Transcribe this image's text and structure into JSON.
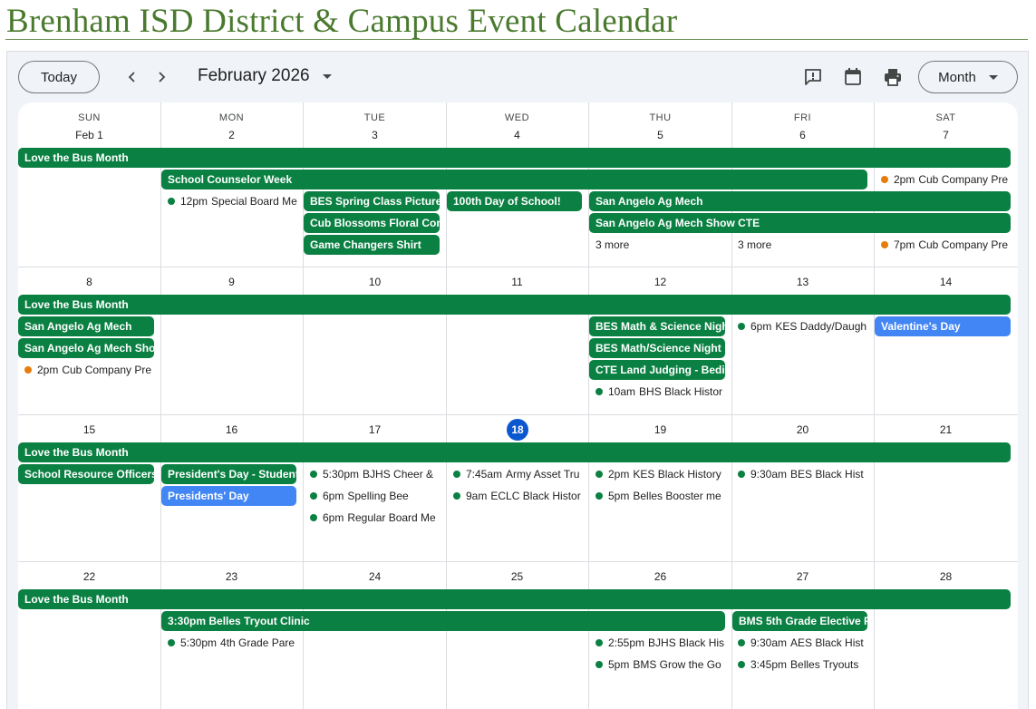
{
  "page_title": "Brenham ISD District & Campus Event Calendar",
  "toolbar": {
    "today_label": "Today",
    "prev_icon": "chevron-left-icon",
    "next_icon": "chevron-right-icon",
    "month_label": "February 2026",
    "feedback_icon": "feedback-icon",
    "calendar_icon": "calendar-icon",
    "print_icon": "print-icon",
    "view_label": "Month"
  },
  "days_of_week": [
    "SUN",
    "MON",
    "TUE",
    "WED",
    "THU",
    "FRI",
    "SAT"
  ],
  "weeks": [
    {
      "days": [
        "Feb 1",
        "2",
        "3",
        "4",
        "5",
        "6",
        "7"
      ]
    },
    {
      "days": [
        "8",
        "9",
        "10",
        "11",
        "12",
        "13",
        "14"
      ]
    },
    {
      "days": [
        "15",
        "16",
        "17",
        "18",
        "19",
        "20",
        "21"
      ]
    },
    {
      "days": [
        "22",
        "23",
        "24",
        "25",
        "26",
        "27",
        "28"
      ]
    }
  ],
  "today": "18",
  "events": {
    "w1": {
      "bus": "Love the Bus Month",
      "counselor": "School Counselor Week",
      "cub1_time": "2pm",
      "cub1_title": "Cub Company Pre",
      "board_time": "12pm",
      "board_title": "Special Board Me",
      "bes_spring": "BES Spring Class Picture",
      "hundredth": "100th Day of School!",
      "ag_mech": "San Angelo Ag Mech",
      "blossoms": "Cub Blossoms Floral Com",
      "ag_mech_show": "San Angelo Ag Mech Show CTE",
      "game_changers": "Game Changers Shirt",
      "more_thu": "3 more",
      "more_fri": "3 more",
      "cub2_time": "7pm",
      "cub2_title": "Cub Company Pre"
    },
    "w2": {
      "bus": "Love the Bus Month",
      "ag_mech": "San Angelo Ag Mech",
      "ag_mech_show": "San Angelo Ag Mech Sho",
      "cub_time": "2pm",
      "cub_title": "Cub Company Pre",
      "bes_math1": "BES Math & Science Nigh",
      "bes_math2": "BES Math/Science Night",
      "cte_land": "CTE Land Judging - Bedi",
      "bhs_time": "10am",
      "bhs_title": "BHS Black Histor",
      "kes_time": "6pm",
      "kes_title": "KES Daddy/Daugh",
      "valentine": "Valentine's Day"
    },
    "w3": {
      "bus": "Love the Bus Month",
      "sro": "School Resource Officers",
      "presidents_student": "President's Day - Student",
      "presidents": "Presidents' Day",
      "bjhs_time": "5:30pm",
      "bjhs_title": "BJHS Cheer &",
      "spelling_time": "6pm",
      "spelling_title": "Spelling Bee",
      "board_time": "6pm",
      "board_title": "Regular Board Me",
      "army_time": "7:45am",
      "army_title": "Army Asset Tru",
      "eclc_time": "9am",
      "eclc_title": "ECLC Black Histor",
      "kes_time": "2pm",
      "kes_title": "KES Black History",
      "belles_time": "5pm",
      "belles_title": "Belles Booster me",
      "bes_time": "9:30am",
      "bes_title": "BES Black Hist"
    },
    "w4": {
      "bus": "Love the Bus Month",
      "belles_clinic": "3:30pm Belles Tryout Clinic",
      "bms5": "BMS 5th Grade Elective F",
      "parent_time": "5:30pm",
      "parent_title": "4th Grade Pare",
      "bjhs_time": "2:55pm",
      "bjhs_title": "BJHS Black His",
      "bms_time": "5pm",
      "bms_title": "BMS Grow the Go",
      "aes_time": "9:30am",
      "aes_title": "AES Black Hist",
      "tryouts_time": "3:45pm",
      "tryouts_title": "Belles Tryouts"
    }
  },
  "colors": {
    "title_green": "#4a7a2e",
    "event_green": "#0b8043",
    "event_blue": "#4285f4",
    "dot_orange": "#e67c0c",
    "today_blue": "#0b57d0"
  }
}
